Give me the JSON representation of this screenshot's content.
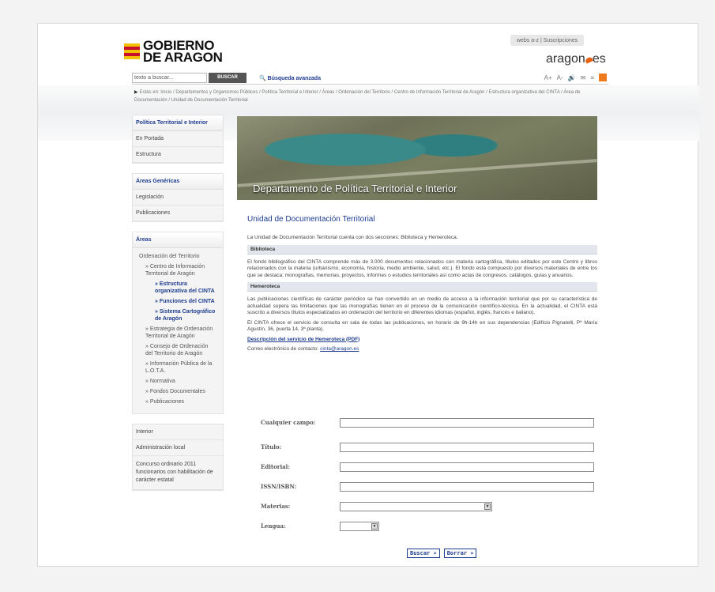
{
  "header": {
    "logo_line1": "GOBIERNO",
    "logo_line2": "DE ARAGON",
    "top_links": "webs a-z | Suscripciones",
    "brand": "aragon",
    "brand_suffix": "es"
  },
  "search": {
    "placeholder": "texto a buscar...",
    "value": "texto a buscar...",
    "button": "BUSCAR",
    "advanced": "Búsqueda avanzada",
    "font_up": "A+",
    "font_down": "A-"
  },
  "breadcrumb": "Estás en: Inicio / Departamentos y Organismos Públicos / Política Territorial e Interior / Áreas / Ordenación del Territorio / Centro de Información Territorial de Aragón / Estructura organizativa del CINTA / Área de Documentación / Unidad de Documentación Territorial",
  "sidebar": {
    "box1": {
      "head": "Política Territorial e Interior",
      "items": [
        "En Portada",
        "Estructura"
      ]
    },
    "box2": {
      "head": "Áreas Genéricas",
      "items": [
        "Legislación",
        "Publicaciones"
      ]
    },
    "box3": {
      "head": "Áreas",
      "tree": {
        "root": "Ordenación del Territorio",
        "centro": "» Centro de Información Territorial de Aragón",
        "estructura": "» Estructura organizativa del CINTA",
        "funciones": "» Funciones del CINTA",
        "sistema": "» Sistema Cartográfico de Aragón",
        "estrategia": "» Estrategia de Ordenación Territorial de Aragón",
        "consejo": "» Consejo de Ordenación del Territorio de Aragón",
        "info": "» Información Pública de la L.O.T.A.",
        "normativa": "» Normativa",
        "fondos": "» Fondos Documentales",
        "publicaciones": "» Publicaciones"
      }
    },
    "box4": {
      "items": [
        "Interior",
        "Administración local",
        "Concurso ordinario 2011 funcionarios con habilitación de carácter estatal"
      ]
    }
  },
  "banner": {
    "title": "Departamento de Política Territorial e Interior"
  },
  "content": {
    "title": "Unidad de Documentación Territorial",
    "intro": "La Unidad de Documentación Territorial cuenta con dos secciones: Biblioteca y Hemeroteca.",
    "sec1": "Biblioteca",
    "p1": "El fondo bibliográfico del CINTA comprende más de 3.000 documentos relacionados con materia cartográfica, títulos editados por este Centro y libros relacionados con la materia (urbanismo, economía, historia, medio ambiente, salud, etc.). El fondo está compuesto por diversos materiales de entre los que se destaca: monografías, memorias, proyectos, informes o estudios territoriales así como actas de congresos, catálogos, guías y anuarios.",
    "sec2": "Hemeroteca",
    "p2": "Las publicaciones científicas de carácter periódico se han convertido en un medio de acceso a la información territorial que por su característica de actualidad supera las limitaciones que las monografías tienen en el proceso de la comunicación científico-técnica. En la actualidad, el CINTA está suscrito a diversos títulos especializados en ordenación del territorio en diferentes idiomas (español, inglés, francés e italiano).",
    "p3": "El CINTA ofrece el servicio de consulta en sala de todas las publicaciones, en horario de 9h-14h en sus dependencias (Edificio Pignatelli, Pº María Agustín, 36, puerta 14, 3ª planta).",
    "link": "Descripción del servicio de Hemeroteca (PDF)",
    "contact": "Correo electrónico de contacto: ",
    "email": "cinta@aragon.es"
  },
  "form": {
    "f1": "Cualquier campo:",
    "f2": "Título:",
    "f3": "Editorial:",
    "f4": "ISSN/ISBN:",
    "f5": "Materias:",
    "f6": "Lengua:",
    "search_btn": "Buscar »",
    "clear_btn": "Borrar »"
  }
}
